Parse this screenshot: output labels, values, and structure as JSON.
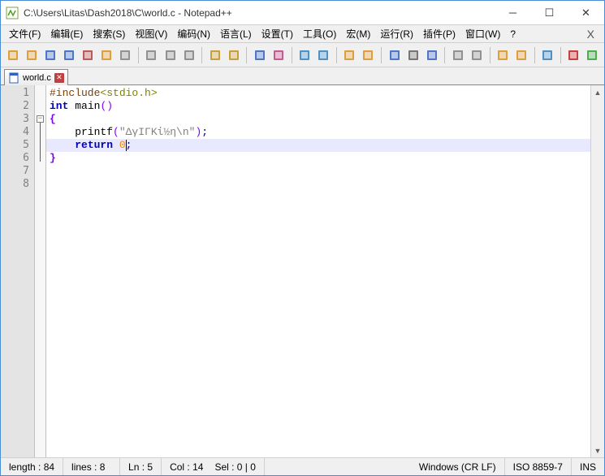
{
  "window": {
    "title": "C:\\Users\\Litas\\Dash2018\\C\\world.c - Notepad++"
  },
  "menu": {
    "file": "文件(F)",
    "edit": "编辑(E)",
    "search": "搜索(S)",
    "view": "视图(V)",
    "encoding": "编码(N)",
    "language": "语言(L)",
    "settings": "设置(T)",
    "tools": "工具(O)",
    "macro": "宏(M)",
    "run": "运行(R)",
    "plugins": "插件(P)",
    "window": "窗口(W)",
    "help": "?"
  },
  "tab": {
    "name": "world.c"
  },
  "code": {
    "lines": [
      {
        "n": 1,
        "tokens": [
          [
            "pre",
            "#include"
          ],
          [
            "inc",
            "<stdio.h>"
          ]
        ]
      },
      {
        "n": 2,
        "tokens": [
          [
            "kw",
            "int"
          ],
          [
            "",
            " "
          ],
          [
            "",
            "main"
          ],
          [
            "paren",
            "()"
          ]
        ]
      },
      {
        "n": 3,
        "tokens": [
          [
            "brace",
            "{"
          ]
        ]
      },
      {
        "n": 4,
        "tokens": [
          [
            "",
            "    printf"
          ],
          [
            "paren",
            "("
          ],
          [
            "str",
            "\"ΔγΙΓΚί½η\\n\""
          ],
          [
            "paren",
            ")"
          ],
          [
            "op",
            ";"
          ]
        ]
      },
      {
        "n": 5,
        "tokens": [
          [
            "",
            "    "
          ],
          [
            "kw",
            "return"
          ],
          [
            "",
            " "
          ],
          [
            "num",
            "0"
          ],
          [
            "op",
            ";"
          ]
        ]
      },
      {
        "n": 6,
        "tokens": [
          [
            "brace",
            "}"
          ]
        ]
      },
      {
        "n": 7,
        "tokens": []
      },
      {
        "n": 8,
        "tokens": []
      }
    ],
    "highlight_line": 5
  },
  "status": {
    "length": "length : 84",
    "lines": "lines : 8",
    "ln": "Ln : 5",
    "col": "Col : 14",
    "sel": "Sel : 0 | 0",
    "eol": "Windows (CR LF)",
    "enc": "ISO 8859-7",
    "mode": "INS"
  },
  "toolbar_icons": [
    "new-file",
    "open-file",
    "save-file",
    "save-all",
    "close-file",
    "close-all",
    "print",
    "sep",
    "cut",
    "copy",
    "paste",
    "sep",
    "undo",
    "redo",
    "sep",
    "find",
    "replace",
    "sep",
    "zoom-in",
    "zoom-out",
    "sep",
    "sync-v",
    "sync-h",
    "sep",
    "wrap",
    "all-chars",
    "indent-guide",
    "sep",
    "lang",
    "doc-map",
    "sep",
    "func-list",
    "folder",
    "sep",
    "monitor",
    "sep",
    "record",
    "play"
  ],
  "icon_colors": {
    "new-file": "#d89020",
    "open-file": "#d89020",
    "save-file": "#3060c0",
    "save-all": "#3060c0",
    "close-file": "#b04040",
    "close-all": "#d89020",
    "print": "#808080",
    "cut": "#808080",
    "copy": "#808080",
    "paste": "#808080",
    "undo": "#c09020",
    "redo": "#c09020",
    "find": "#3060c0",
    "replace": "#c04080",
    "zoom-in": "#3080c0",
    "zoom-out": "#3080c0",
    "sync-v": "#d89020",
    "sync-h": "#d89020",
    "wrap": "#3060c0",
    "all-chars": "#606060",
    "indent-guide": "#3060c0",
    "lang": "#808080",
    "doc-map": "#808080",
    "func-list": "#d89020",
    "folder": "#d89020",
    "monitor": "#3080c0",
    "record": "#c02020",
    "play": "#30a030"
  }
}
